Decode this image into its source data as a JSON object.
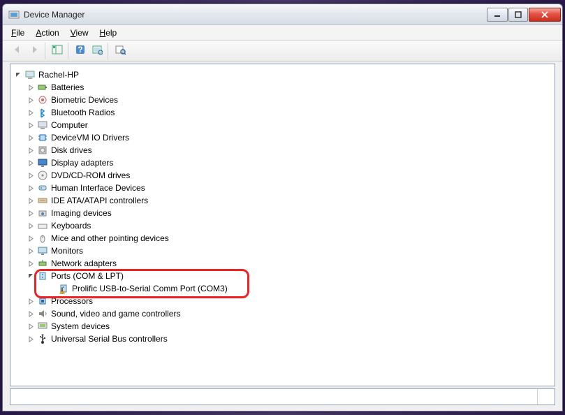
{
  "window": {
    "title": "Device Manager"
  },
  "menu": {
    "file": "File",
    "action": "Action",
    "view": "View",
    "help": "Help",
    "file_u": "F",
    "action_u": "A",
    "view_u": "V",
    "help_u": "H"
  },
  "tree": {
    "root": {
      "label": "Rachel-HP"
    },
    "items": [
      {
        "label": "Batteries",
        "icon": "battery"
      },
      {
        "label": "Biometric Devices",
        "icon": "biometric"
      },
      {
        "label": "Bluetooth Radios",
        "icon": "bluetooth"
      },
      {
        "label": "Computer",
        "icon": "computer"
      },
      {
        "label": "DeviceVM IO Drivers",
        "icon": "chip"
      },
      {
        "label": "Disk drives",
        "icon": "disk"
      },
      {
        "label": "Display adapters",
        "icon": "display"
      },
      {
        "label": "DVD/CD-ROM drives",
        "icon": "dvd"
      },
      {
        "label": "Human Interface Devices",
        "icon": "hid"
      },
      {
        "label": "IDE ATA/ATAPI controllers",
        "icon": "ide"
      },
      {
        "label": "Imaging devices",
        "icon": "imaging"
      },
      {
        "label": "Keyboards",
        "icon": "keyboard"
      },
      {
        "label": "Mice and other pointing devices",
        "icon": "mouse"
      },
      {
        "label": "Monitors",
        "icon": "monitor"
      },
      {
        "label": "Network adapters",
        "icon": "network"
      },
      {
        "label": "Ports (COM & LPT)",
        "icon": "port",
        "expanded": true,
        "children": [
          {
            "label": "Prolific USB-to-Serial Comm Port (COM3)",
            "icon": "port-warn"
          }
        ]
      },
      {
        "label": "Processors",
        "icon": "cpu"
      },
      {
        "label": "Sound, video and game controllers",
        "icon": "sound"
      },
      {
        "label": "System devices",
        "icon": "system"
      },
      {
        "label": "Universal Serial Bus controllers",
        "icon": "usb"
      }
    ]
  }
}
